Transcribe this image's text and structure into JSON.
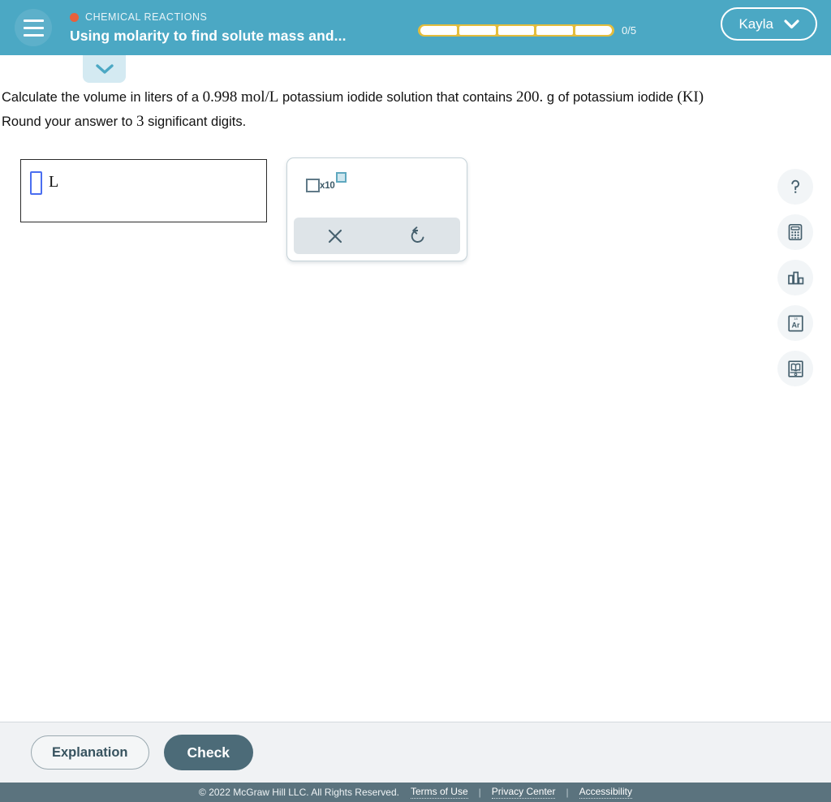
{
  "header": {
    "menu_icon": "hamburger-icon",
    "category": "CHEMICAL REACTIONS",
    "category_dot_color": "#e8603c",
    "lesson_title": "Using molarity to find solute mass and...",
    "background_color": "#4ba8c4",
    "progress": {
      "total_segments": 5,
      "filled_segments": 0,
      "count_label": "0/5",
      "bar_color": "#e3bd3d"
    },
    "user": {
      "name": "Kayla",
      "chevron_icon": "chevron-down-icon"
    }
  },
  "collapse_tab": {
    "icon": "chevron-down-icon",
    "color": "#d4eaf2"
  },
  "question": {
    "line1": [
      {
        "type": "text",
        "value": "Calculate the volume in liters of a "
      },
      {
        "type": "math",
        "value": "0.998"
      },
      {
        "type": "text",
        "value": " "
      },
      {
        "type": "math",
        "value": "mol/L"
      },
      {
        "type": "text",
        "value": " potassium iodide solution that contains "
      },
      {
        "type": "math",
        "value": "200."
      },
      {
        "type": "text",
        "value": " g of potassium iodide "
      },
      {
        "type": "math",
        "value": "(KI)"
      }
    ],
    "line2": [
      {
        "type": "text",
        "value": "Round your answer to "
      },
      {
        "type": "math",
        "value": "3"
      },
      {
        "type": "text",
        "value": " significant digits."
      }
    ]
  },
  "answer": {
    "value": "",
    "placeholder": "",
    "unit": "L"
  },
  "keypad": {
    "scientific_key": {
      "base_label": "",
      "times_ten_label": "x10",
      "exponent_label": "",
      "exponent_highlight_color": "#cfe7ef"
    },
    "actions": [
      {
        "name": "clear",
        "icon": "close-x-icon"
      },
      {
        "name": "undo",
        "icon": "undo-arrow-icon"
      }
    ]
  },
  "tools": [
    {
      "name": "help",
      "icon": "question-mark-icon",
      "label": "?"
    },
    {
      "name": "calculator",
      "icon": "calculator-icon",
      "label": ""
    },
    {
      "name": "data-chart",
      "icon": "bar-chart-icon",
      "label": ""
    },
    {
      "name": "periodic-table",
      "icon": "periodic-table-icon",
      "label": "Ar"
    },
    {
      "name": "reference-book",
      "icon": "open-book-icon",
      "label": ""
    }
  ],
  "actions": {
    "explanation_label": "Explanation",
    "check_label": "Check",
    "check_color": "#4c6b78"
  },
  "footer": {
    "copyright": "© 2022 McGraw Hill LLC. All Rights Reserved.",
    "separator": "|",
    "links": [
      "Terms of Use",
      "Privacy Center",
      "Accessibility"
    ],
    "background_color": "#5b737e"
  }
}
